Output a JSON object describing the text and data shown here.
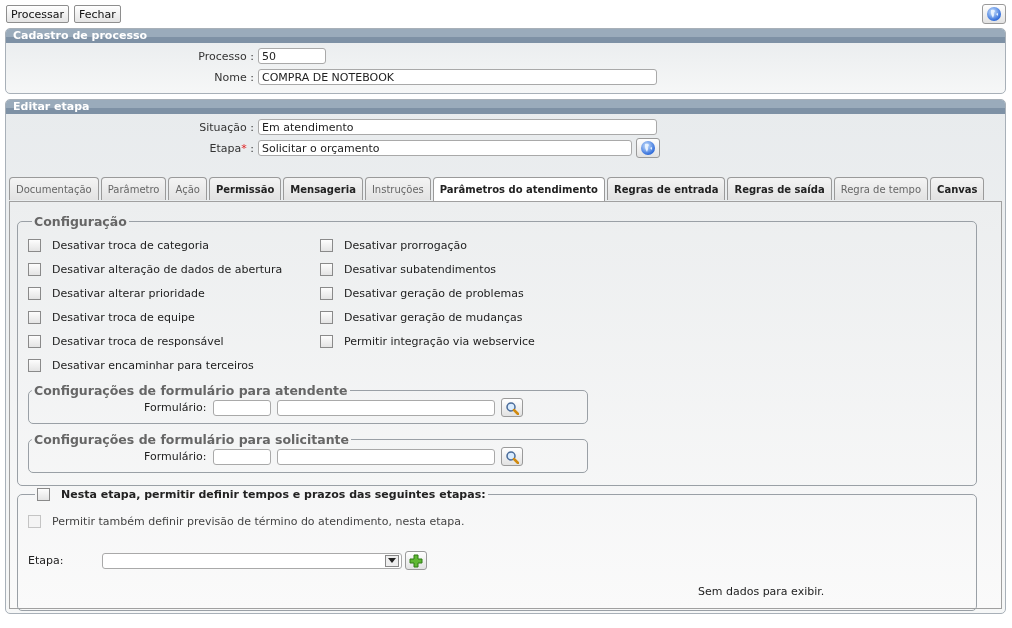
{
  "toolbar": {
    "buttons": [
      "Processar",
      "Fechar"
    ]
  },
  "cadastro": {
    "title": "Cadastro de processo",
    "fields": [
      {
        "label": "Processo :",
        "value": "50"
      },
      {
        "label": "Nome :",
        "value": "COMPRA DE NOTEBOOK"
      }
    ]
  },
  "editar": {
    "title": "Editar etapa",
    "situacao": {
      "label": "Situação :",
      "value": "Em atendimento"
    },
    "etapa": {
      "label": "Etapa",
      "required": "*",
      "colon": ":",
      "value": "Solicitar o orçamento"
    }
  },
  "tabs": [
    {
      "label": "Documentação",
      "selected": false,
      "disabled": true
    },
    {
      "label": "Parâmetro",
      "selected": false,
      "disabled": true
    },
    {
      "label": "Ação",
      "selected": false,
      "disabled": true
    },
    {
      "label": "Permissão",
      "selected": false,
      "disabled": false
    },
    {
      "label": "Mensageria",
      "selected": false,
      "disabled": false
    },
    {
      "label": "Instruções",
      "selected": false,
      "disabled": true
    },
    {
      "label": "Parâmetros do atendimento",
      "selected": true,
      "disabled": false
    },
    {
      "label": "Regras de entrada",
      "selected": false,
      "disabled": false
    },
    {
      "label": "Regras de saída",
      "selected": false,
      "disabled": false
    },
    {
      "label": "Regra de tempo",
      "selected": false,
      "disabled": true
    },
    {
      "label": "Canvas",
      "selected": false,
      "disabled": false
    }
  ],
  "configuracao": {
    "title": "Configuração",
    "column_1": [
      {
        "label": "Desativar troca de categoria",
        "checked": false
      },
      {
        "label": "Desativar alteração de dados de abertura",
        "checked": false
      },
      {
        "label": "Desativar alterar prioridade",
        "checked": false
      },
      {
        "label": "Desativar troca de equipe",
        "checked": false
      },
      {
        "label": "Desativar troca de responsável",
        "checked": false
      },
      {
        "label": "Desativar encaminhar para terceiros",
        "checked": false
      }
    ],
    "column_2": [
      {
        "label": "Desativar prorrogação",
        "checked": false
      },
      {
        "label": "Desativar subatendimentos",
        "checked": false
      },
      {
        "label": "Desativar geração de problemas",
        "checked": false
      },
      {
        "label": "Desativar geração de mudanças",
        "checked": false
      },
      {
        "label": "Permitir integração via webservice",
        "checked": false
      }
    ],
    "forms": [
      {
        "title": "Configurações de formulário para atendente",
        "label": "Formulário:"
      },
      {
        "title": "Configurações de formulário para solicitante",
        "label": "Formulário:"
      }
    ]
  },
  "prazos": {
    "title": "Nesta etapa, permitir definir tempos e prazos das seguintes etapas:",
    "checked": false,
    "option": {
      "label": "Permitir também definir previsão de término do atendimento, nesta etapa.",
      "checked": false,
      "disabled": true
    },
    "etapa_label": "Etapa:",
    "empty_text": "Sem dados para exibir."
  }
}
